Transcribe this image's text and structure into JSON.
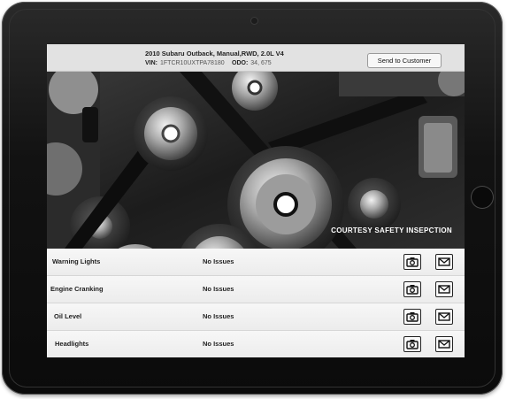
{
  "vehicle": {
    "title": "2010 Subaru Outback, Manual,RWD, 2.0L V4",
    "vin_label": "VIN:",
    "vin": "1FTCR10UXTPA78180",
    "odo_label": "ODO:",
    "odo": "34, 675"
  },
  "actions": {
    "send_label": "Send to Customer"
  },
  "hero": {
    "banner": "COURTESY SAFETY INSEPCTION"
  },
  "inspection": [
    {
      "item": "Warning Lights",
      "status": "No Issues",
      "camera_icon": "camera-icon",
      "email_icon": "envelope-icon"
    },
    {
      "item": "Engine Cranking",
      "status": "No Issues",
      "camera_icon": "camera-icon",
      "email_icon": "envelope-icon"
    },
    {
      "item": "Oil Level",
      "status": "No Issues",
      "camera_icon": "camera-icon",
      "email_icon": "envelope-icon"
    },
    {
      "item": "Headlights",
      "status": "No Issues",
      "camera_icon": "camera-icon",
      "email_icon": "envelope-icon"
    }
  ]
}
